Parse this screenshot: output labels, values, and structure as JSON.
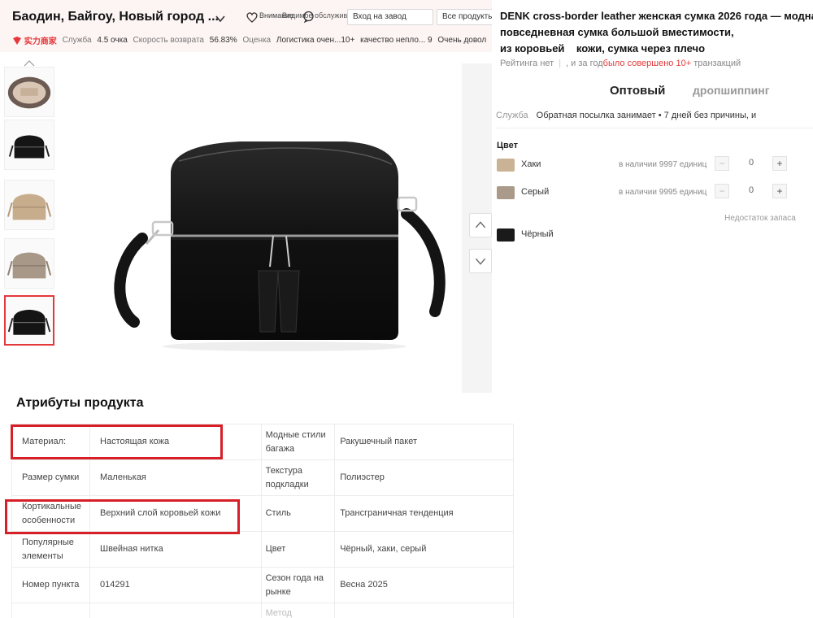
{
  "store": {
    "name": "Баодин, Байгоу, Новый город ...",
    "follow_label": "Внимание",
    "overlap_1": "Видимое обслуживание клиентов",
    "overlap_2": "Вход на завод",
    "all_products_label": "Все продукты",
    "badge_text": "实力商家",
    "metrics": [
      {
        "label": "Служба",
        "value": "4.5 очка"
      },
      {
        "label": "Скорость возврата",
        "value": "56.83%"
      },
      {
        "label": "Оценка",
        "value": "Логистика очен...10+"
      },
      {
        "label": "",
        "value": "качество непло... 9"
      },
      {
        "label": "",
        "value": "Очень довол"
      }
    ]
  },
  "product": {
    "title_lines": [
      "DENK cross-border leather женская сумка 2026 года — модная",
      "повседневная сумка большой вместимости,",
      "из коровьей    кожи, сумка через плечо"
    ],
    "rating_text": "Рейтинга нет",
    "transactions_prefix": ", и за год",
    "transactions_red": "было совершено 10+",
    "transactions_suffix": " транзакций",
    "tabs": [
      "Оптовый",
      "дропшиппинг"
    ],
    "service_label": "Служба",
    "service_text": "Обратная посылка занимает • 7 дней без причины, и",
    "color_heading": "Цвет",
    "colors": [
      {
        "name": "Хаки",
        "stock": "в наличии 9997 единиц",
        "qty": "0",
        "swatch": "#c9b394",
        "in_stock": true
      },
      {
        "name": "Серый",
        "stock": "в наличии 9995 единиц",
        "qty": "0",
        "swatch": "#a99a89",
        "in_stock": true
      },
      {
        "name": "Чёрный",
        "stock": "Недостаток запаса",
        "qty": "",
        "swatch": "#1a1a1a",
        "in_stock": false
      }
    ]
  },
  "attributes": {
    "title": "Атрибуты продукта",
    "rows": [
      {
        "k1": "Материал:",
        "v1": "Настоящая кожа",
        "k2": "Модные стили багажа",
        "v2": "Ракушечный пакет"
      },
      {
        "k1": "Размер сумки",
        "v1": "Маленькая",
        "k2": "Текстура подкладки",
        "v2": "Полиэстер"
      },
      {
        "k1": "Кортикальные особенности",
        "v1": "Верхний слой коровьей кожи",
        "k2": "Стиль",
        "v2": "Трансграничная тенденция"
      },
      {
        "k1": "Популярные элементы",
        "v1": "Швейная нитка",
        "k2": "Цвет",
        "v2": "Чёрный, хаки, серый"
      },
      {
        "k1": "Номер пункта",
        "v1": "014291",
        "k2": "Сезон года на рынке",
        "v2": "Весна 2025"
      },
      {
        "k1": "",
        "v1": "",
        "k2": "Метод",
        "v2": ""
      }
    ]
  },
  "colors": {
    "accent_red": "#e4393c",
    "highlight_red": "#d61f26",
    "header_bg": "#fdf4f4"
  }
}
